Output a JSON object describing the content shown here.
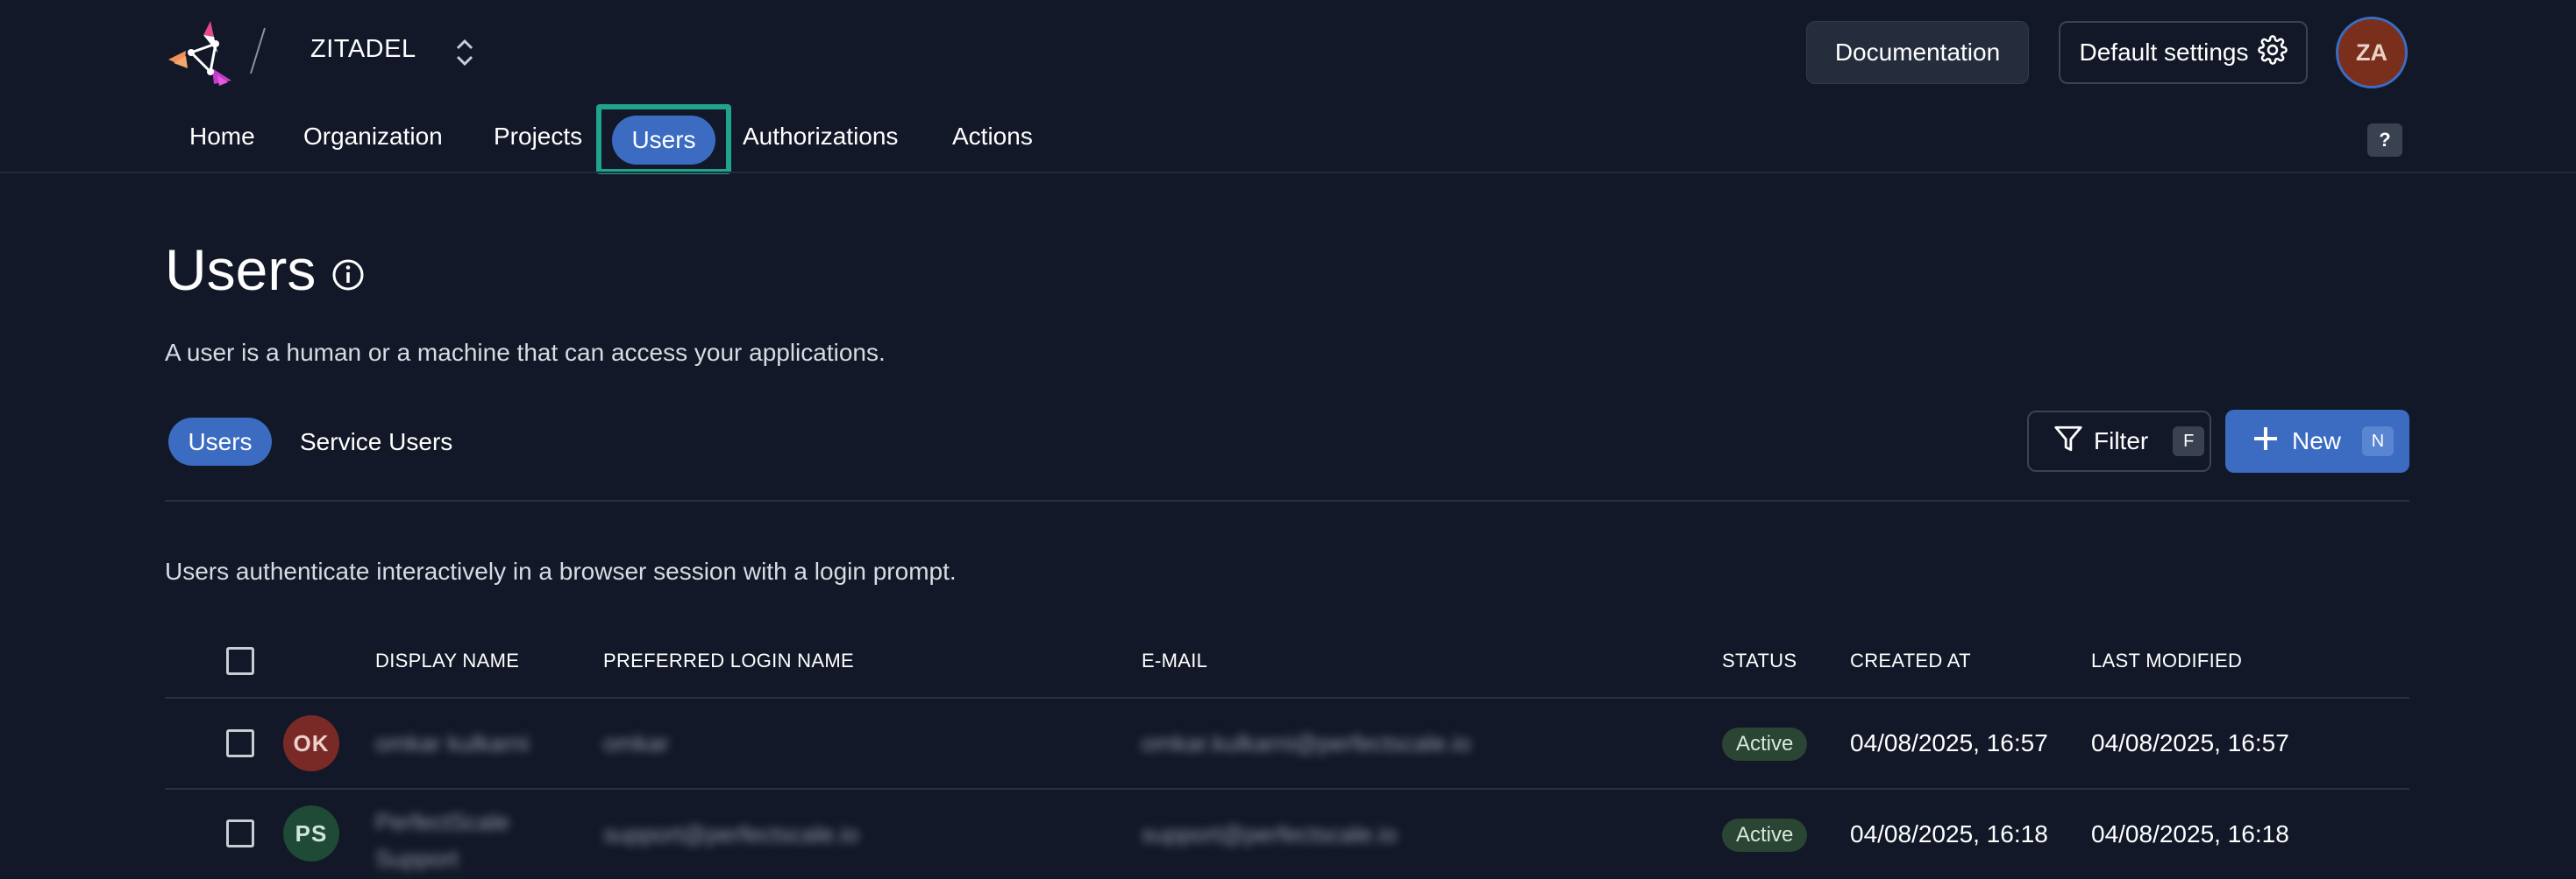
{
  "header": {
    "org_name": "ZITADEL",
    "documentation_label": "Documentation",
    "default_settings_label": "Default settings",
    "avatar_initials": "ZA"
  },
  "nav": {
    "items": [
      "Home",
      "Organization",
      "Projects",
      "Users",
      "Authorizations",
      "Actions"
    ],
    "active": "Users",
    "help_label": "?"
  },
  "page": {
    "title": "Users",
    "description": "A user is a human or a machine that can access your applications."
  },
  "tabs": {
    "users": "Users",
    "service_users": "Service Users"
  },
  "actions": {
    "filter_label": "Filter",
    "filter_shortcut": "F",
    "new_label": "New",
    "new_shortcut": "N"
  },
  "section": {
    "description": "Users authenticate interactively in a browser session with a login prompt."
  },
  "table": {
    "headers": {
      "display_name": "DISPLAY NAME",
      "preferred_login_name": "PREFERRED LOGIN NAME",
      "email": "E-MAIL",
      "status": "STATUS",
      "created_at": "CREATED AT",
      "last_modified": "LAST MODIFIED"
    },
    "rows": [
      {
        "initials": "OK",
        "avatar_color": "#7a2a26",
        "avatar_text_color": "#ecd0cc",
        "display_name": "omkar kulkarni",
        "login_name": "omkar",
        "email": "omkar.kulkarni@perfectscale.io",
        "status": "Active",
        "created_at": "04/08/2025, 16:57",
        "last_modified": "04/08/2025, 16:57"
      },
      {
        "initials": "PS",
        "avatar_color": "#1f4a35",
        "avatar_text_color": "#cfe6d8",
        "display_name_line1": "PerfectScale",
        "display_name_line2": "Support",
        "login_name": "support@perfectscale.io",
        "email": "support@perfectscale.io",
        "status": "Active",
        "created_at": "04/08/2025, 16:18",
        "last_modified": "04/08/2025, 16:18"
      }
    ]
  },
  "colors": {
    "background": "#121827",
    "accent": "#3b6cc2",
    "focus_ring": "#1fa38d",
    "status_active_bg": "#2a4534"
  }
}
